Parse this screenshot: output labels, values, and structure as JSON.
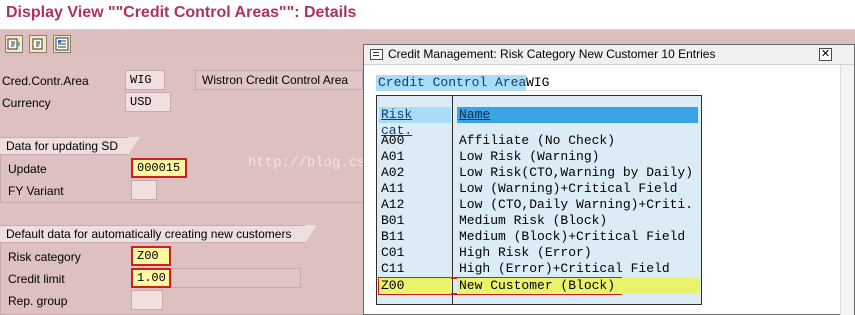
{
  "page": {
    "title": "Display View \"\"Credit Control Areas\"\": Details"
  },
  "toolbar": {
    "buttons": [
      "first-entry-icon",
      "previous-entry-icon",
      "next-entry-icon"
    ]
  },
  "header_fields": {
    "cred_contr_area_label": "Cred.Contr.Area",
    "cred_contr_area_value": "WIG",
    "cred_contr_area_desc": "Wistron Credit Control Area",
    "currency_label": "Currency",
    "currency_value": "USD"
  },
  "group_sd": {
    "title": "Data for updating SD",
    "update_label": "Update",
    "update_value": "000015",
    "fy_variant_label": "FY Variant",
    "fy_variant_value": ""
  },
  "group_defaults": {
    "title": "Default data for automatically creating new customers",
    "risk_category_label": "Risk category",
    "risk_category_value": "Z00",
    "credit_limit_label": "Credit limit",
    "credit_limit_value": "1.00",
    "rep_group_label": "Rep. group",
    "rep_group_value": ""
  },
  "watermark": "http://blog.csdn.net/",
  "popup": {
    "title": "Credit Management: Risk Category New Customer 10 Entries",
    "cca_label": "Credit Control Area",
    "cca_value": "WIG",
    "columns": [
      "Risk cat.",
      "Name"
    ],
    "rows": [
      {
        "cat": "A00",
        "name": "Affiliate (No Check)"
      },
      {
        "cat": "A01",
        "name": "Low Risk (Warning)"
      },
      {
        "cat": "A02",
        "name": "Low Risk(CTO,Warning by Daily)"
      },
      {
        "cat": "A11",
        "name": "Low (Warning)+Critical Field"
      },
      {
        "cat": "A12",
        "name": "Low (CTO,Daily Warning)+Criti."
      },
      {
        "cat": "B01",
        "name": "Medium Risk (Block)"
      },
      {
        "cat": "B11",
        "name": "Medium (Block)+Critical Field"
      },
      {
        "cat": "C01",
        "name": "High Risk (Error)"
      },
      {
        "cat": "C11",
        "name": "High (Error)+Critical Field"
      },
      {
        "cat": "Z00",
        "name": "New Customer (Block)"
      }
    ],
    "highlighted_row": 9
  },
  "colors": {
    "title": "#b03060",
    "background": "#ddc1c1",
    "highlight_field": "#fff8a0",
    "highlight_border": "#cc1f1f",
    "table_bg": "#dcecf7",
    "header_blue": "#3aa3e6"
  }
}
